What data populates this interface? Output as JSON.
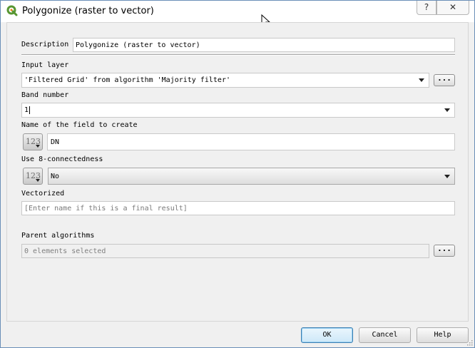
{
  "window": {
    "title": "Polygonize (raster to vector)",
    "help_glyph": "?",
    "close_glyph": "✕"
  },
  "form": {
    "description_label": "Description",
    "description_value": "Polygonize (raster to vector)",
    "input_layer_label": "Input layer",
    "input_layer_value": "'Filtered Grid' from algorithm 'Majority filter'",
    "band_number_label": "Band number",
    "band_number_value": "1",
    "field_name_label": "Name of the field to create",
    "field_name_value": "DN",
    "connectedness_label": "Use 8-connectedness",
    "connectedness_value": "No",
    "vectorized_label": "Vectorized",
    "vectorized_placeholder": "[Enter name if this is a final result]",
    "parent_algorithms_label": "Parent algorithms",
    "parent_algorithms_value": "0 elements selected",
    "dots_label": "...",
    "expr_button_label": "123"
  },
  "buttons": {
    "ok": "OK",
    "cancel": "Cancel",
    "help": "Help"
  },
  "colors": {
    "qgis_green": "#589632",
    "default_button_border": "#3c7fb1"
  },
  "icons": {
    "app": "qgis-logo-icon",
    "cursor": "mouse-pointer-icon"
  }
}
